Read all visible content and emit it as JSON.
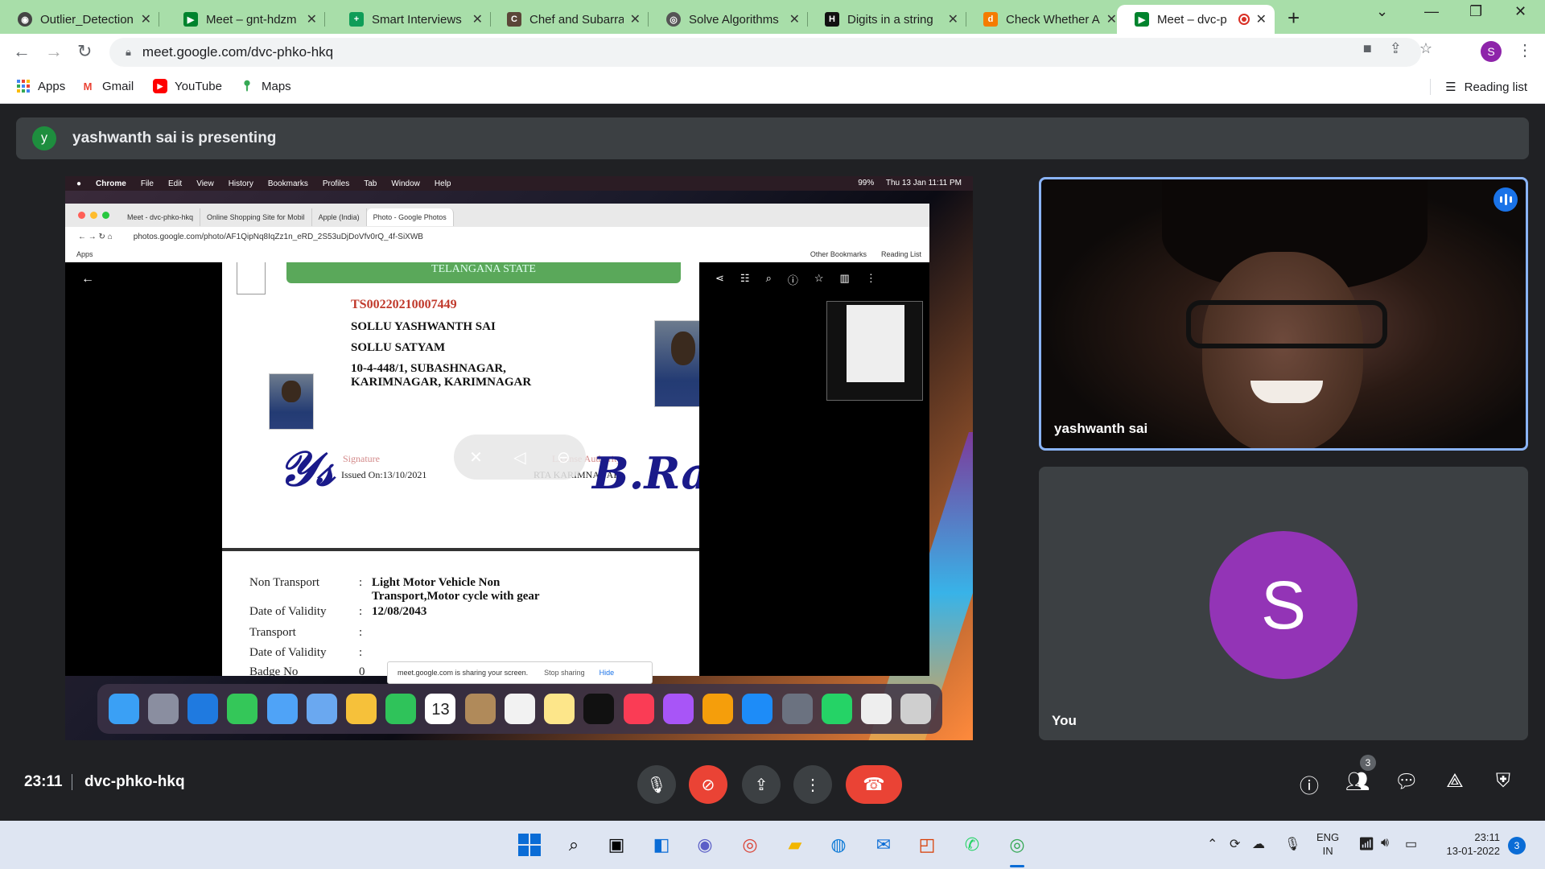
{
  "browser": {
    "tabs": [
      {
        "title": "Outlier_Detection",
        "favicon": "github-icon",
        "color": "#444444"
      },
      {
        "title": "Meet – gnt-hdzm",
        "favicon": "meet-icon",
        "color": "#00832d"
      },
      {
        "title": "Smart Interviews",
        "favicon": "plus-icon",
        "color": "#0f9d58"
      },
      {
        "title": "Chef and Subarra",
        "favicon": "codechef-icon",
        "color": "#5b4638"
      },
      {
        "title": "Solve Algorithms",
        "favicon": "hackerrank-icon",
        "color": "#555555"
      },
      {
        "title": "Digits in a string",
        "favicon": "hackerearth-icon",
        "color": "#111111"
      },
      {
        "title": "Check Whether A",
        "favicon": "d-icon",
        "color": "#f57c00"
      },
      {
        "title": "Meet – dvc-p",
        "favicon": "meet-icon",
        "color": "#00832d",
        "active": true
      }
    ],
    "url": "meet.google.com/dvc-phko-hkq",
    "bookmarks": [
      {
        "label": "Apps"
      },
      {
        "label": "Gmail"
      },
      {
        "label": "YouTube"
      },
      {
        "label": "Maps"
      }
    ],
    "reading_list": "Reading list",
    "profile_initial": "S"
  },
  "meet": {
    "presenter_initial": "y",
    "presenting_text": "yashwanth sai is presenting",
    "time": "23:11",
    "meeting_code": "dvc-phko-hkq",
    "participants_count": "3",
    "tiles": [
      {
        "name": "yashwanth sai"
      },
      {
        "name": "You",
        "initial": "S"
      }
    ]
  },
  "shared_screen": {
    "menubar": {
      "items": [
        "Chrome",
        "File",
        "Edit",
        "View",
        "History",
        "Bookmarks",
        "Profiles",
        "Tab",
        "Window",
        "Help"
      ],
      "status": "99%",
      "datetime": "Thu 13 Jan  11:11 PM"
    },
    "inner_tabs": [
      {
        "title": "Meet - dvc-phko-hkq"
      },
      {
        "title": "Online Shopping Site for Mobil"
      },
      {
        "title": "Apple (India)"
      },
      {
        "title": "Photo - Google Photos",
        "active": true
      }
    ],
    "inner_url": "photos.google.com/photo/AF1QipNq8IqZz1n_eRD_2S53uDjDoVfv0rQ_4f-SiXWB",
    "inner_bookmarks": {
      "apps": "Apps",
      "other": "Other Bookmarks",
      "reading": "Reading List"
    },
    "license": {
      "banner": "TELANGANA STATE",
      "number": "TS00220210007449",
      "name": "SOLLU YASHWANTH SAI",
      "relation": "SOLLU SATYAM",
      "address_1": "10-4-448/1, SUBASHNAGAR,",
      "address_2": "KARIMNAGAR, KARIMNAGAR",
      "signature_label": "Signature",
      "authority_label": "License Authority",
      "issued_on": "Issued On:13/10/2021",
      "rta": "RTA KARIMNAGAR",
      "rows": [
        {
          "label": "Non Transport",
          "value": "Light Motor Vehicle Non",
          "value2": "Transport,Motor cycle with gear"
        },
        {
          "label": "Date of Validity",
          "value": "12/08/2043"
        },
        {
          "label": "Transport",
          "value": ""
        },
        {
          "label": "Date of Validity",
          "value": ""
        },
        {
          "label": "Badge No",
          "value": "0"
        }
      ]
    },
    "share_notice": {
      "text": "meet.google.com is sharing your screen.",
      "stop": "Stop sharing",
      "hide": "Hide"
    },
    "dock_calendar_day": "13"
  },
  "taskbar": {
    "lang_1": "ENG",
    "lang_2": "IN",
    "time": "23:11",
    "date": "13-01-2022",
    "notifications": "3"
  }
}
